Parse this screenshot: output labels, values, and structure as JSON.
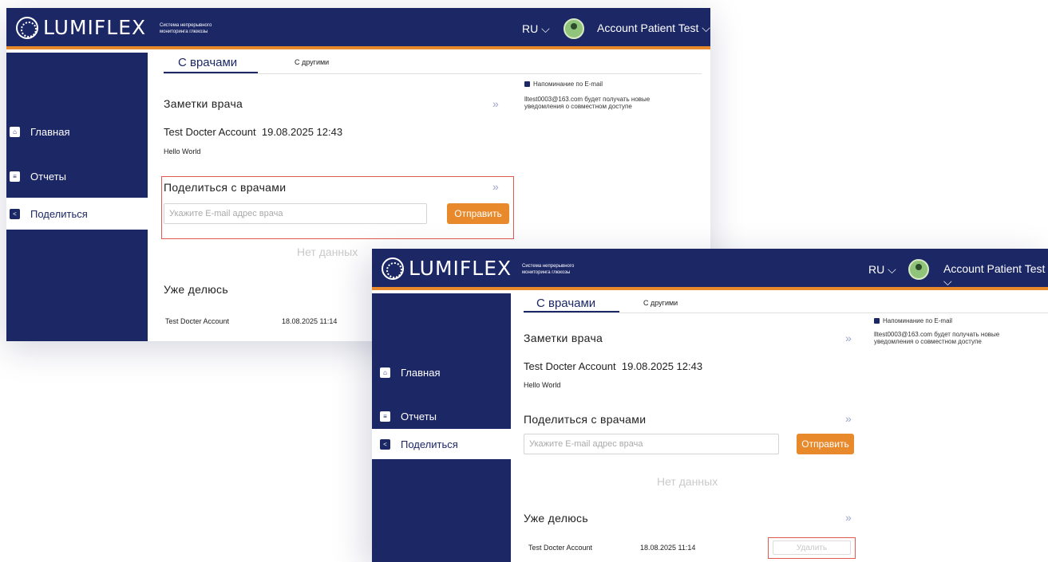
{
  "app": {
    "brand": "LUMIFLEX",
    "tagline": "Система непрерывного мониторинга глюкозы",
    "language": "RU",
    "account_name": "Account Patient Test"
  },
  "sidebar": {
    "items": [
      {
        "label": "Главная",
        "icon": "home-icon",
        "active": false
      },
      {
        "label": "Отчеты",
        "icon": "reports-icon",
        "active": false
      },
      {
        "label": "Поделиться",
        "icon": "share-icon",
        "active": true
      }
    ]
  },
  "tabs": [
    {
      "label": "С врачами",
      "active": true
    },
    {
      "label": "С другими",
      "active": false
    }
  ],
  "notes": {
    "title": "Заметки врача",
    "doctor": "Test Docter Account",
    "datetime": "19.08.2025 12:43",
    "text": "Hello World"
  },
  "share": {
    "title": "Поделиться с врачами",
    "email_placeholder": "Укажите E-mail адрес врача",
    "send_label": "Отправить",
    "empty_label": "Нет данных"
  },
  "already_sharing": {
    "title": "Уже делюсь",
    "rows": [
      {
        "name": "Test Docter Account",
        "date": "18.08.2025 11:14",
        "delete_label": "Удалить"
      }
    ]
  },
  "email_notice": {
    "checkbox_label": "Напоминание по E-mail",
    "text": "lltest0003@163.com будет получать новые уведомления о совместном доступе"
  },
  "colors": {
    "navy": "#1c2766",
    "accent_orange": "#e8892b",
    "highlight_red": "#e05a4f"
  }
}
